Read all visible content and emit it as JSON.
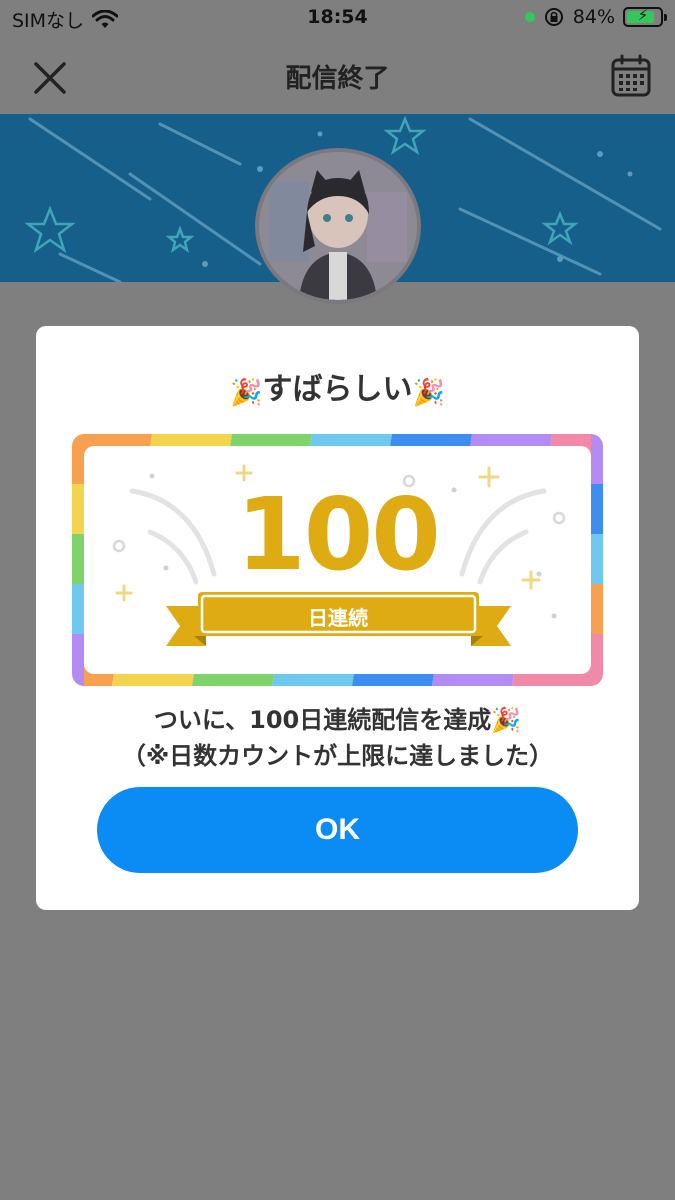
{
  "status_bar": {
    "carrier": "SIMなし",
    "time": "18:54",
    "battery_percent": "84%",
    "battery_level": 0.84
  },
  "nav": {
    "title": "配信終了"
  },
  "modal": {
    "title_text": "すばらしい",
    "title_emoji": "🎉",
    "badge_number": "100",
    "badge_label": "日連続",
    "message_line1": "ついに、100日連続配信を達成🎉",
    "message_line2": "（※日数カウントが上限に達しました）",
    "ok_label": "OK"
  },
  "colors": {
    "accent": "#0a8cf4",
    "gold": "#dfab13",
    "banner": "#165f8a",
    "overlay": "#7f7f7f"
  }
}
